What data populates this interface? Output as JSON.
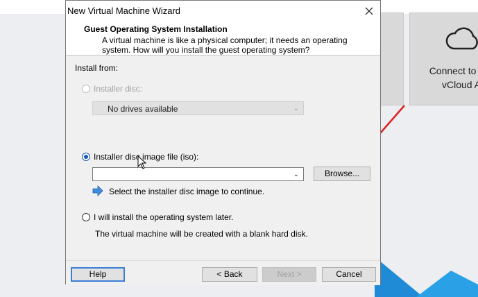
{
  "background_app": {
    "tile_text_line1": "Connect to VM",
    "tile_text_line2": "vCloud A",
    "accent_color": "#1f8ad6"
  },
  "dialog": {
    "title": "New Virtual Machine Wizard",
    "header_title": "Guest Operating System Installation",
    "header_description": "A virtual machine is like a physical computer; it needs an operating system. How will you install the guest operating system?",
    "install_from_label": "Install from:",
    "options": {
      "installer_disc": {
        "label": "Installer disc:",
        "checked": false,
        "disabled": true
      },
      "disc_image": {
        "label": "Installer disc image file (iso):",
        "checked": true
      },
      "install_later": {
        "label": "I will install the operating system later.",
        "checked": false
      }
    },
    "drive_select_value": "No drives available",
    "iso_path_value": "",
    "browse_label": "Browse...",
    "hint_text": "Select the installer disc image to continue.",
    "later_description": "The virtual machine will be created with a blank hard disk.",
    "footer": {
      "help_label": "Help",
      "back_label": "< Back",
      "next_label": "Next >",
      "cancel_label": "Cancel"
    }
  }
}
